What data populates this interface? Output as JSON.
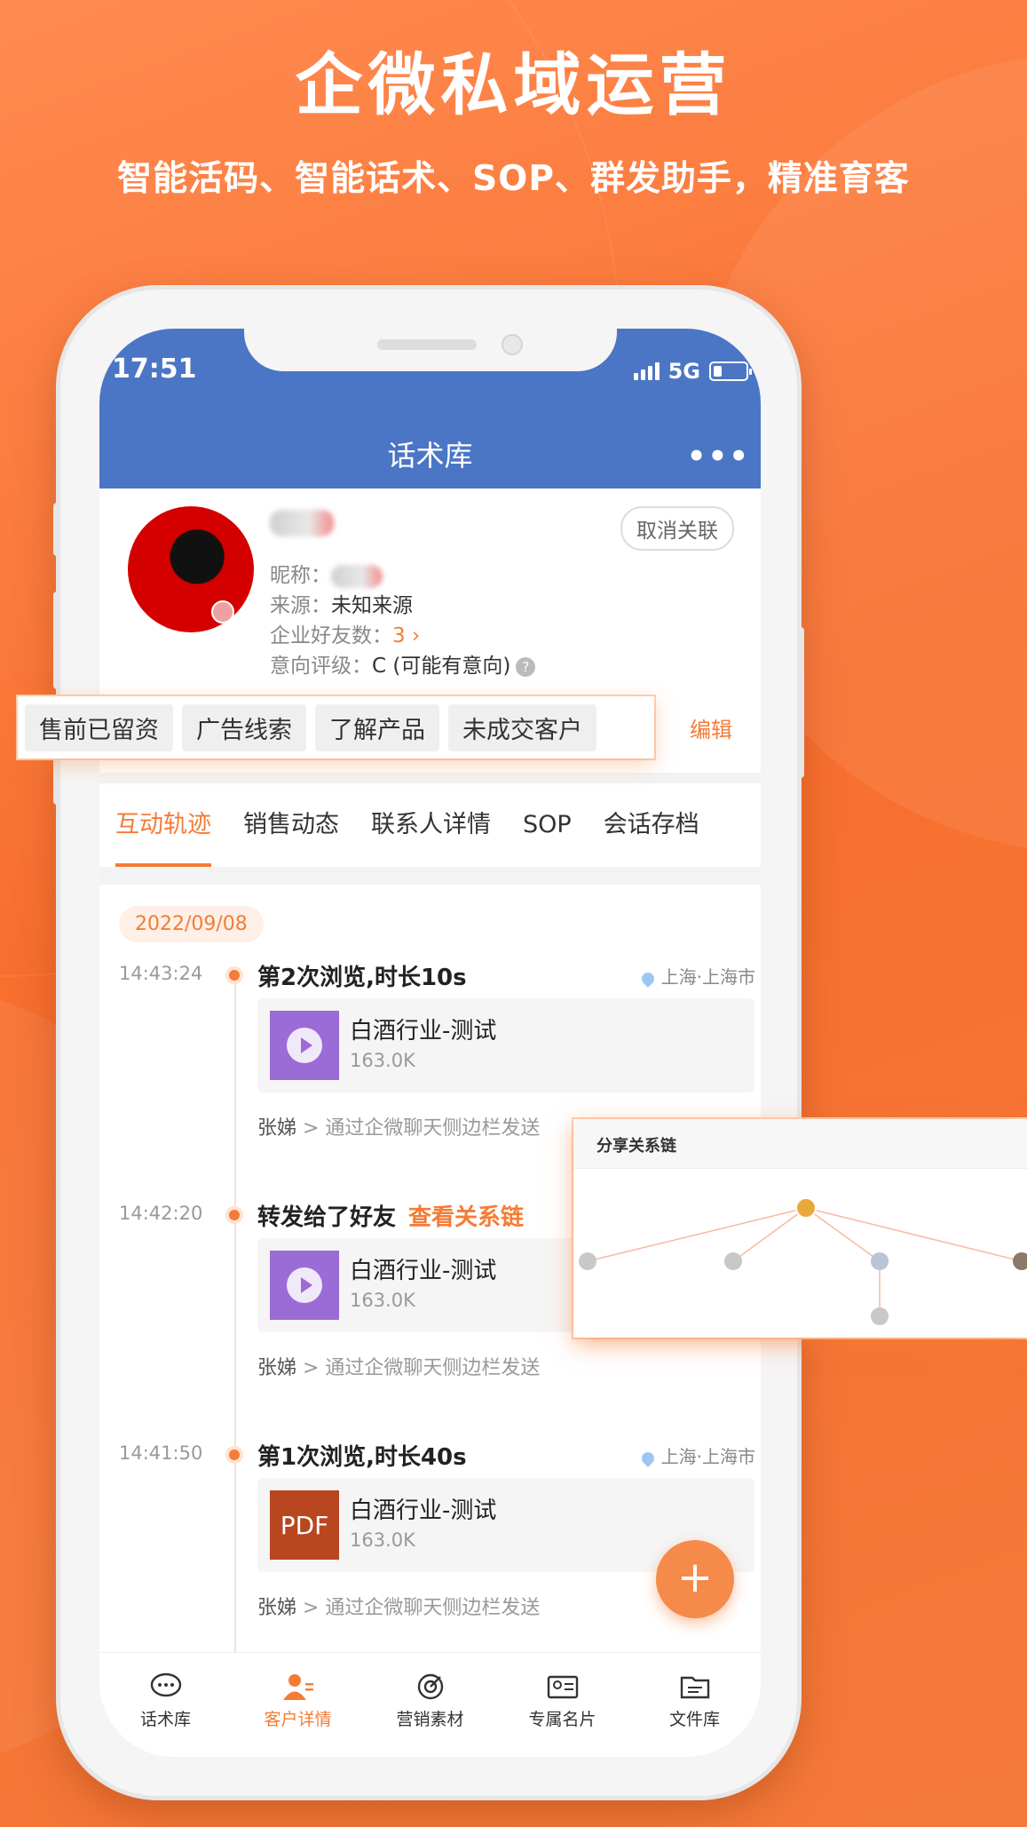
{
  "banner": {
    "title": "企微私域运营",
    "subtitle": "智能活码、智能话术、SOP、群发助手，精准育客"
  },
  "status_bar": {
    "time": "17:51",
    "network": "5G"
  },
  "nav": {
    "title": "话术库",
    "more": "•••"
  },
  "profile": {
    "unlink_label": "取消关联",
    "nickname_label": "昵称：",
    "source_label": "来源：",
    "source_value": "未知来源",
    "friends_label": "企业好友数：",
    "friends_value": "3 ›",
    "rating_label": "意向评级：",
    "rating_value": "C (可能有意向)",
    "help_icon": "?"
  },
  "tags": [
    "售前已留资",
    "广告线索",
    "了解产品",
    "未成交客户"
  ],
  "edit_label": "编辑",
  "tabs": [
    "互动轨迹",
    "销售动态",
    "联系人详情",
    "SOP",
    "会话存档"
  ],
  "timeline": {
    "date": "2022/09/08",
    "events": [
      {
        "time": "14:43:24",
        "title": "第2次浏览,时长10s",
        "location": "上海·上海市",
        "file_name": "白酒行业-测试",
        "file_size": "163.0K",
        "file_type": "video",
        "sender": "张娣",
        "via": " > 通过企微聊天侧边栏发送"
      },
      {
        "time": "14:42:20",
        "title": "转发给了好友",
        "link": "查看关系链",
        "file_name": "白酒行业-测试",
        "file_size": "163.0K",
        "file_type": "video",
        "sender": "张娣",
        "via": " > 通过企微聊天侧边栏发送"
      },
      {
        "time": "14:41:50",
        "title": "第1次浏览,时长40s",
        "location": "上海·上海市",
        "file_name": "白酒行业-测试",
        "file_size": "163.0K",
        "file_type": "pdf",
        "pdf_label": "PDF",
        "sender": "张娣",
        "via": " > 通过企微聊天侧边栏发送"
      }
    ]
  },
  "fab": "+",
  "bottom_nav": [
    {
      "label": "话术库",
      "icon": "chat-bubble-icon"
    },
    {
      "label": "客户详情",
      "icon": "customer-icon",
      "active": true
    },
    {
      "label": "营销素材",
      "icon": "target-icon"
    },
    {
      "label": "专属名片",
      "icon": "business-card-icon"
    },
    {
      "label": "文件库",
      "icon": "folder-icon"
    }
  ],
  "relation_card": {
    "title": "分享关系链"
  },
  "colors": {
    "accent": "#F47C36",
    "nav_blue": "#4B76C5",
    "background": "#FB7A3C"
  }
}
